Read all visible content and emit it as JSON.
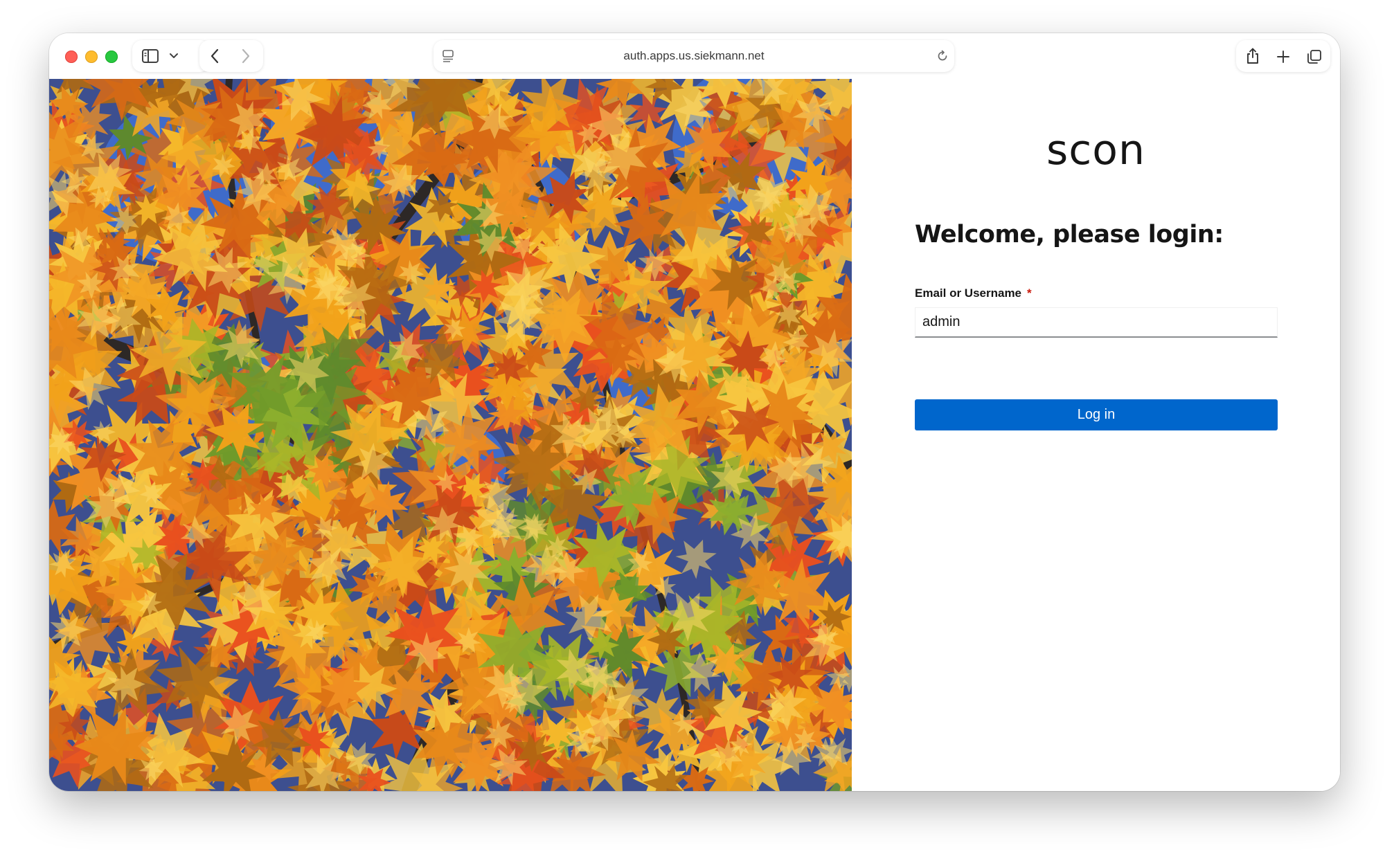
{
  "browser": {
    "address_url": "auth.apps.us.siekmann.net",
    "icons": [
      "sidebar-icon",
      "chevron-down-icon",
      "back-icon",
      "forward-icon",
      "reader-icon",
      "reload-icon",
      "share-icon",
      "new-tab-icon",
      "tabs-overview-icon"
    ]
  },
  "login": {
    "logo_text": "scon",
    "heading": "Welcome, please login:",
    "username_label": "Email or Username",
    "required_marker": "*",
    "username_value": "admin",
    "submit_label": "Log in"
  },
  "colors": {
    "primary_button": "#0066cc",
    "required": "#c9190b",
    "text": "#151515"
  }
}
